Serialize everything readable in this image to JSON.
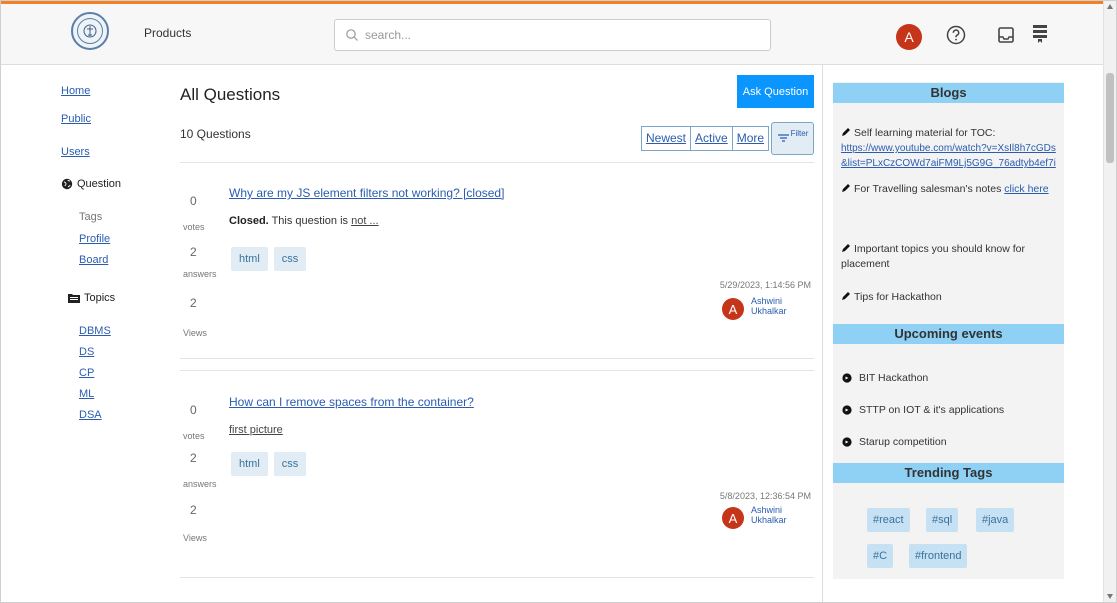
{
  "header": {
    "products_label": "Products",
    "search_placeholder": "search...",
    "avatar_letter": "A"
  },
  "nav": {
    "home": "Home",
    "public": "Public",
    "users": "Users",
    "question_heading": "Question",
    "tags": "Tags",
    "profile": "Profile",
    "board": "Board",
    "topics_heading": "Topics",
    "topics": [
      "DBMS",
      "DS",
      "CP",
      "ML",
      "DSA"
    ]
  },
  "main": {
    "title": "All Questions",
    "ask_button": "Ask Question",
    "question_count": "10 Questions",
    "tabs": [
      "Newest",
      "Active",
      "More"
    ],
    "filter_label": "Filter",
    "questions": [
      {
        "votes": "0",
        "votes_label": "votes",
        "answers": "2",
        "answers_label": "answers",
        "views": "2",
        "views_label": "Views",
        "title": "Why are my JS element filters not working? [closed]",
        "excerpt_bold": "Closed.",
        "excerpt_text": " This question is ",
        "excerpt_underlined": "not ...",
        "tags": [
          "html",
          "css"
        ],
        "date": "5/29/2023, 1:14:56 PM",
        "avatar_letter": "A",
        "author": "Ashwini Ukhalkar"
      },
      {
        "votes": "0",
        "votes_label": "votes",
        "answers": "2",
        "answers_label": "answers",
        "views": "2",
        "views_label": "Views",
        "title": "How can I remove spaces from the container?",
        "excerpt_underlined": "first picture",
        "tags": [
          "html",
          "css"
        ],
        "date": "5/8/2023, 12:36:54 PM",
        "avatar_letter": "A",
        "author": "Ashwini Ukhalkar"
      }
    ]
  },
  "sidebar": {
    "blogs_title": "Blogs",
    "blog1_text": "Self learning material for TOC:",
    "blog1_link": "https://www.youtube.com/watch?v=XsIl8h7cGDs&list=PLxCzCOWd7aiFM9Lj5G9G_76adtyb4ef7i",
    "blog2_text": "For Travelling salesman's notes ",
    "blog2_link": "click here",
    "blog3_text": "Important topics you should know for placement",
    "blog4_text": "Tips for Hackathon",
    "events_title": "Upcoming events",
    "events": [
      "BIT Hackathon",
      "STTP on IOT & it's applications",
      "Starup competition"
    ],
    "trending_title": "Trending Tags",
    "trending_tags": [
      "#react",
      "#sql",
      "#java",
      "#C",
      "#frontend"
    ]
  },
  "colors": {
    "accent_orange": "#f48024",
    "primary_blue": "#0a95ff",
    "link_blue": "#2a5db0",
    "tag_bg": "#e1ecf4",
    "sidebar_header": "#8ed1f5",
    "avatar_red": "#c4351a"
  },
  "icons": [
    "logo-emblem",
    "search-icon",
    "help-icon",
    "inbox-icon",
    "menu-icon",
    "globe-icon",
    "folder-icon",
    "filter-icon",
    "pencil-icon",
    "event-bullet-icon"
  ]
}
